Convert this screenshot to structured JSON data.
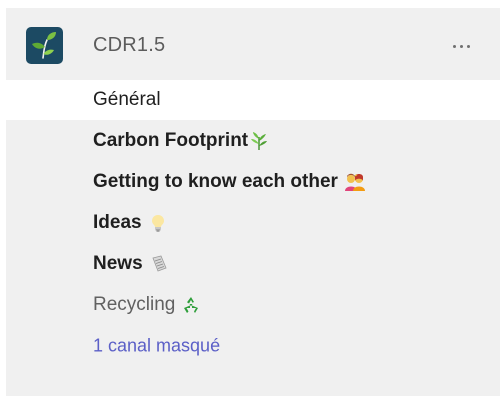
{
  "team": {
    "name": "CDR1.5",
    "logo_icon": "plant-sprout-icon",
    "more_icon": "more-options-icon"
  },
  "channels": [
    {
      "label": "Général",
      "bold": false,
      "selected": true,
      "emoji": ""
    },
    {
      "label": "Carbon Footprint",
      "bold": true,
      "selected": false,
      "emoji": "herb-emoji-icon"
    },
    {
      "label": "Getting to know each other",
      "bold": true,
      "selected": false,
      "emoji": "couple-emoji-icon"
    },
    {
      "label": "Ideas",
      "bold": true,
      "selected": false,
      "emoji": "lightbulb-emoji-icon"
    },
    {
      "label": "News",
      "bold": true,
      "selected": false,
      "emoji": "newspaper-emoji-icon"
    },
    {
      "label": "Recycling",
      "bold": false,
      "selected": false,
      "emoji": "recycling-emoji-icon"
    }
  ],
  "hidden_channels": {
    "label": "1 canal masqué"
  },
  "colors": {
    "panel_background": "#f0f0f0",
    "selected_background": "#ffffff",
    "link": "#5b5fc7",
    "logo_background": "#1c4a63"
  }
}
